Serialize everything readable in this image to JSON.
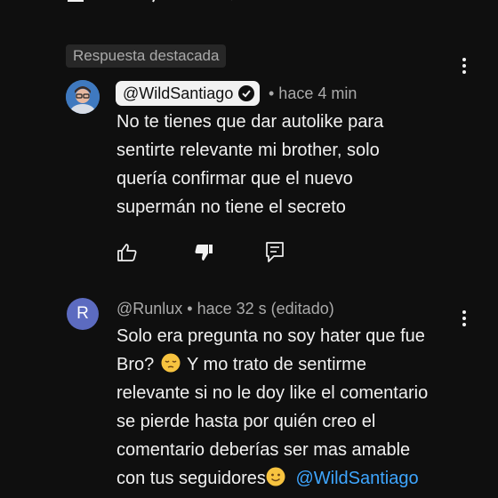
{
  "featured_label": "Respuesta destacada",
  "comment1": {
    "handle": "@WildSantiago",
    "time": "• hace 4 min",
    "lines": [
      "No te tienes que dar autolike para",
      "sentirte relevante mi brother, solo",
      "quería confirmar que el nuevo",
      "supermán no tiene el secreto"
    ],
    "icons": [
      "thumb-up-icon",
      "thumb-down-filled-icon",
      "reply-icon"
    ]
  },
  "comment2": {
    "avatar_letter": "R",
    "handle_meta": "@Runlux • hace 32 s (editado)",
    "lines": [
      "Solo era pregunta no soy hater que fue",
      "Bro?",
      " Y mo trato de sentirme",
      "relevante si no le doy like el comentario",
      "se pierde hasta por quién creo el",
      "comentario deberías ser mas amable",
      "con tus seguidores"
    ],
    "mention": "@WildSantiago"
  },
  "colors": {
    "background": "#0f0f0f",
    "text": "#f1f1f1",
    "muted": "#aaaaaa",
    "mention": "#3ea6ff",
    "avatar2": "#5c6bc0"
  }
}
